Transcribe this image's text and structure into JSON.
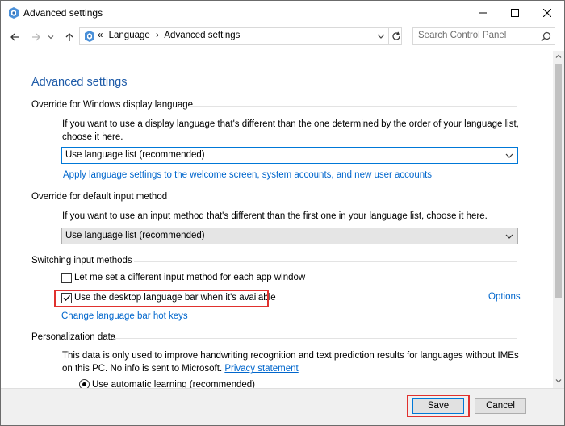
{
  "window": {
    "title": "Advanced settings",
    "icon": "control-panel-icon"
  },
  "titlebar_buttons": [
    "minimize-icon",
    "maximize-icon",
    "close-icon"
  ],
  "nav": {
    "back_icon": "arrow-left-icon",
    "forward_icon": "arrow-right-icon",
    "recent_icon": "chevron-down-icon",
    "up_icon": "arrow-up-icon",
    "breadcrumb_prefix": "«",
    "breadcrumbs": [
      "Language",
      "Advanced settings"
    ],
    "separator": "›",
    "search_placeholder": "Search Control Panel"
  },
  "page": {
    "heading": "Advanced settings",
    "display_lang": {
      "title": "Override for Windows display language",
      "desc": "If you want to use a display language that's different than the one determined by the order of your language list, choose it here.",
      "select_value": "Use language list (recommended)",
      "link": "Apply language settings to the welcome screen, system accounts, and new user accounts"
    },
    "input_method": {
      "title": "Override for default input method",
      "desc": "If you want to use an input method that's different than the first one in your language list, choose it here.",
      "select_value": "Use language list (recommended)"
    },
    "switching": {
      "title": "Switching input methods",
      "check1_label": "Let me set a different input method for each app window",
      "check1_checked": false,
      "check2_label": "Use the desktop language bar when it's available",
      "check2_checked": true,
      "options_link": "Options",
      "hotkeys_link": "Change language bar hot keys"
    },
    "personalization": {
      "title": "Personalization data",
      "desc": "This data is only used to improve handwriting recognition and text prediction results for languages without IMEs on this PC. No info is sent to Microsoft.",
      "privacy_link": "Privacy statement",
      "radio_label": "Use automatic learning (recommended)"
    }
  },
  "footer": {
    "save_label": "Save",
    "cancel_label": "Cancel"
  },
  "colors": {
    "heading": "#1e5ba8",
    "link": "#0066cc",
    "highlight": "#e0312e",
    "focus": "#0078d7"
  }
}
